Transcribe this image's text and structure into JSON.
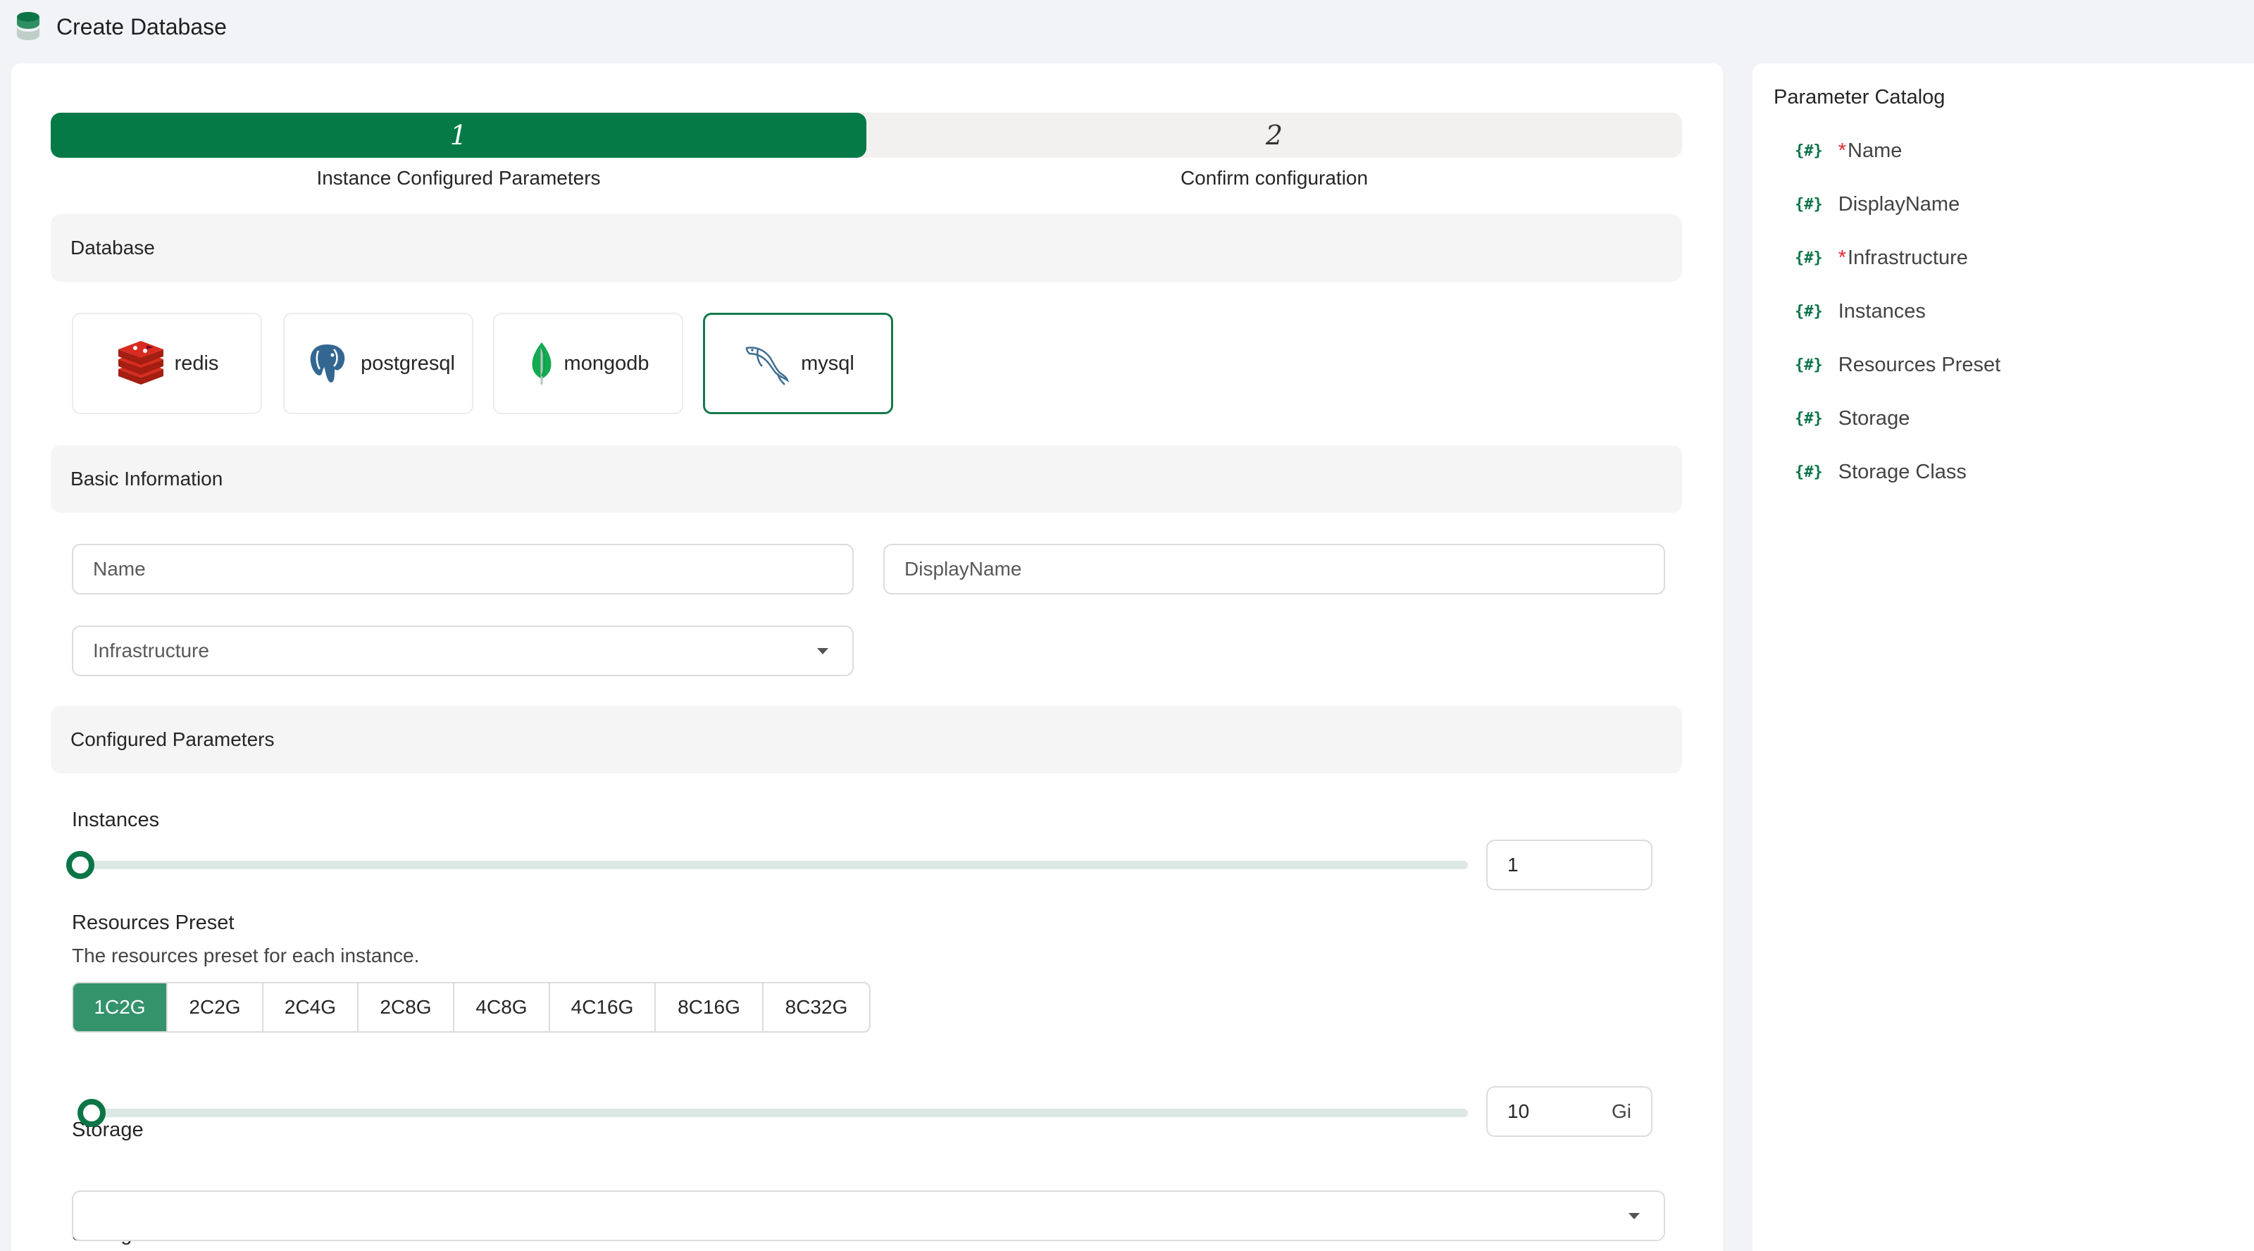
{
  "window": {
    "title": "Create Database"
  },
  "steps": [
    {
      "number": "1",
      "label": "Instance Configured Parameters",
      "active": true
    },
    {
      "number": "2",
      "label": "Confirm configuration",
      "active": false
    }
  ],
  "sections": {
    "database": "Database",
    "basic": "Basic Information",
    "configured": "Configured Parameters"
  },
  "databases": [
    {
      "name": "redis",
      "icon": "redis-icon",
      "selected": false
    },
    {
      "name": "postgresql",
      "icon": "postgresql-elephant-icon",
      "selected": false
    },
    {
      "name": "mongodb",
      "icon": "mongodb-leaf-icon",
      "selected": false
    },
    {
      "name": "mysql",
      "icon": "mysql-dolphin-icon",
      "selected": true
    }
  ],
  "form": {
    "name_placeholder": "Name",
    "display_name_placeholder": "DisplayName",
    "infrastructure_placeholder": "Infrastructure",
    "instances": {
      "label": "Instances",
      "value": "1"
    },
    "resources": {
      "label": "Resources Preset",
      "description": "The resources preset for each instance.",
      "options": [
        "1C2G",
        "2C2G",
        "2C4G",
        "2C8G",
        "4C8G",
        "4C16G",
        "8C16G",
        "8C32G"
      ],
      "selected": "1C2G"
    },
    "storage": {
      "label": "Storage",
      "value": "10",
      "unit": "Gi"
    },
    "storage_class": {
      "label": "Storage Class",
      "value": ""
    }
  },
  "catalog": {
    "title": "Parameter Catalog",
    "icon_text": "{#}",
    "items": [
      {
        "label": "Name",
        "required": true
      },
      {
        "label": "DisplayName",
        "required": false
      },
      {
        "label": "Infrastructure",
        "required": true
      },
      {
        "label": "Instances",
        "required": false
      },
      {
        "label": "Resources Preset",
        "required": false
      },
      {
        "label": "Storage",
        "required": false
      },
      {
        "label": "Storage Class",
        "required": false
      }
    ],
    "required_mark": "*"
  },
  "colors": {
    "accent": "#057a46",
    "preset_active": "#35936b",
    "required": "#e0282e"
  }
}
